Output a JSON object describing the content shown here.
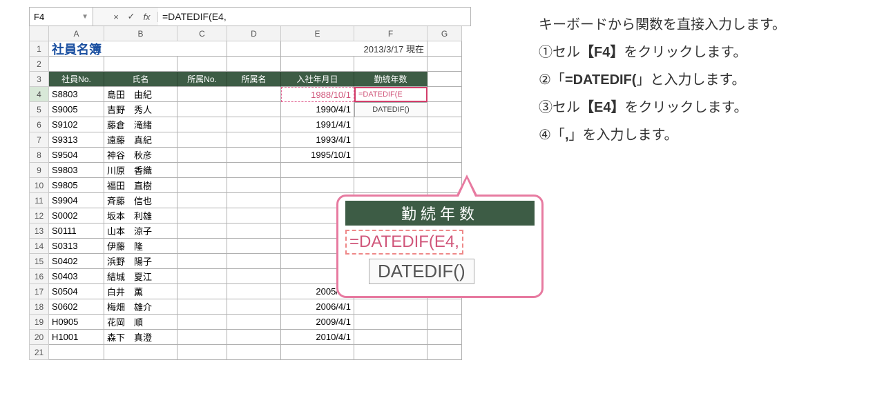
{
  "formula_bar": {
    "cell_ref": "F4",
    "cancel": "×",
    "confirm": "✓",
    "fx": "fx",
    "formula": "=DATEDIF(E4,"
  },
  "columns": [
    "A",
    "B",
    "C",
    "D",
    "E",
    "F",
    "G"
  ],
  "sheet": {
    "title": "社員名簿",
    "date_text": "2013/3/17 現在",
    "headers": [
      "社員No.",
      "氏名",
      "所属No.",
      "所属名",
      "入社年月日",
      "勤続年数"
    ],
    "rows": [
      {
        "n": "4",
        "a": "S8803",
        "b": "島田　由紀",
        "e": "1988/10/1",
        "f": "=DATEDIF(E",
        "f5hint": "DATEDIF()"
      },
      {
        "n": "5",
        "a": "S9005",
        "b": "吉野　秀人",
        "e": "1990/4/1"
      },
      {
        "n": "6",
        "a": "S9102",
        "b": "藤倉　滝緒",
        "e": "1991/4/1"
      },
      {
        "n": "7",
        "a": "S9313",
        "b": "遠藤　真紀",
        "e": "1993/4/1"
      },
      {
        "n": "8",
        "a": "S9504",
        "b": "神谷　秋彦",
        "e": "1995/10/1"
      },
      {
        "n": "9",
        "a": "S9803",
        "b": "川原　香織",
        "e": ""
      },
      {
        "n": "10",
        "a": "S9805",
        "b": "福田　直樹",
        "e": ""
      },
      {
        "n": "11",
        "a": "S9904",
        "b": "斉藤　信也",
        "e": ""
      },
      {
        "n": "12",
        "a": "S0002",
        "b": "坂本　利雄",
        "e": ""
      },
      {
        "n": "13",
        "a": "S0111",
        "b": "山本　涼子",
        "e": ""
      },
      {
        "n": "14",
        "a": "S0313",
        "b": "伊藤　隆",
        "e": ""
      },
      {
        "n": "15",
        "a": "S0402",
        "b": "浜野　陽子",
        "e": ""
      },
      {
        "n": "16",
        "a": "S0403",
        "b": "結城　夏江",
        "e": ""
      },
      {
        "n": "17",
        "a": "S0504",
        "b": "白井　薫",
        "e": "2005/4/1"
      },
      {
        "n": "18",
        "a": "S0602",
        "b": "梅畑　雄介",
        "e": "2006/4/1"
      },
      {
        "n": "19",
        "a": "H0905",
        "b": "花岡　順",
        "e": "2009/4/1"
      },
      {
        "n": "20",
        "a": "H1001",
        "b": "森下　真澄",
        "e": "2010/4/1"
      }
    ]
  },
  "callout": {
    "header": "勤続年数",
    "formula": "=DATEDIF(E4,",
    "hint": "DATEDIF()"
  },
  "instructions": {
    "line1_pre": "キーボードから関数を直接入力します。",
    "line2_pre": "①セル",
    "line2_bold": "【F4】",
    "line2_post": "をクリックします。",
    "line3_pre": "②「",
    "line3_bold": "=DATEDIF(",
    "line3_post": "」と入力します。",
    "line4_pre": "③セル",
    "line4_bold": "【E4】",
    "line4_post": "をクリックします。",
    "line5_pre": "④「",
    "line5_bold": ",",
    "line5_post": "」を入力します。"
  }
}
